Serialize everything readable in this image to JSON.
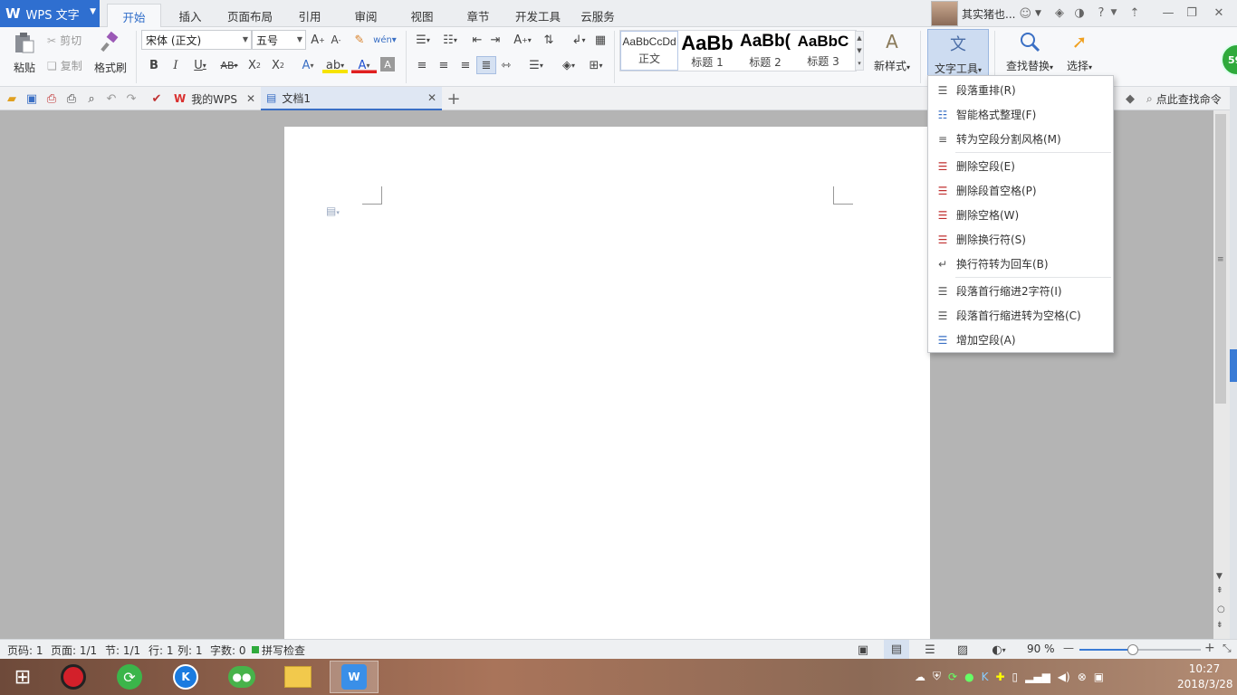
{
  "app": {
    "title": "WPS 文字"
  },
  "tabs": [
    "开始",
    "插入",
    "页面布局",
    "引用",
    "审阅",
    "视图",
    "章节",
    "开发工具",
    "云服务"
  ],
  "user": {
    "name": "其实猪也..."
  },
  "ribbon": {
    "paste": "粘贴",
    "cut": "剪切",
    "copy": "复制",
    "format_painter": "格式刷",
    "font": "宋体 (正文)",
    "size": "五号",
    "styles": [
      {
        "preview": "AaBbCcDd",
        "name": "正文"
      },
      {
        "preview": "AaBb",
        "name": "标题 1"
      },
      {
        "preview": "AaBb(",
        "name": "标题 2"
      },
      {
        "preview": "AaBbC",
        "name": "标题 3"
      }
    ],
    "new_style": "新样式",
    "text_tools": "文字工具",
    "find_replace": "查找替换",
    "select": "选择"
  },
  "quickbar": {
    "tabs": [
      {
        "label": "我的WPS"
      },
      {
        "label": "文档1"
      }
    ],
    "search": "点此查找命令"
  },
  "menu": {
    "items": [
      "段落重排(R)",
      "智能格式整理(F)",
      "转为空段分割风格(M)",
      "删除空段(E)",
      "删除段首空格(P)",
      "删除空格(W)",
      "删除换行符(S)",
      "换行符转为回车(B)",
      "段落首行缩进2字符(I)",
      "段落首行缩进转为空格(C)",
      "增加空段(A)"
    ]
  },
  "status": {
    "page_code": "页码: 1",
    "page": "页面: 1/1",
    "section": "节: 1/1",
    "row": "行: 1",
    "col": "列: 1",
    "words": "字数: 0",
    "spell": "拼写检查",
    "zoom": "90 %"
  },
  "badge": "59",
  "taskbar": {
    "time": "10:27",
    "date": "2018/3/28"
  },
  "colors": {
    "accent": "#2f6fd0",
    "tab_active": "#2e6cc9"
  }
}
